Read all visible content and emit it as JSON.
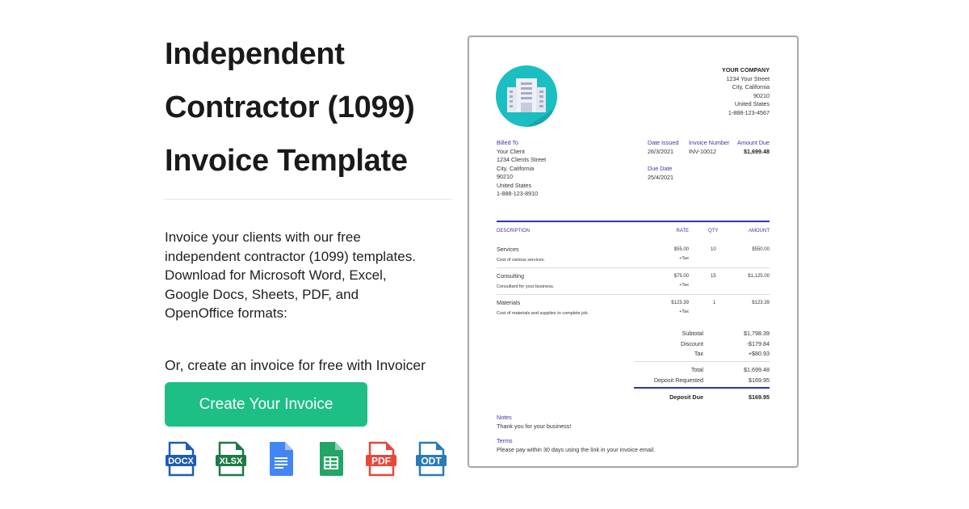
{
  "page": {
    "title_lines": [
      "Independent",
      "Contractor (1099)",
      "Invoice Template"
    ],
    "description": "Invoice your clients with our free independent contractor (1099) templates. Download for Microsoft Word, Excel, Google Docs, Sheets, PDF, and OpenOffice formats:",
    "cta_text": "Or, create an invoice for free with Invoicer",
    "cta_button": "Create Your Invoice",
    "formats": [
      {
        "label": "DOCX",
        "icon": "docx-file-icon",
        "color": "#1e5bb8"
      },
      {
        "label": "XLSX",
        "icon": "xlsx-file-icon",
        "color": "#1d7a45"
      },
      {
        "label": "",
        "icon": "google-docs-icon",
        "color": "#4285f4"
      },
      {
        "label": "",
        "icon": "google-sheets-icon",
        "color": "#23a566"
      },
      {
        "label": "PDF",
        "icon": "pdf-file-icon",
        "color": "#e8473a"
      },
      {
        "label": "ODT",
        "icon": "odt-file-icon",
        "color": "#2a7ab8"
      }
    ]
  },
  "invoice": {
    "company": {
      "name": "YOUR COMPANY",
      "street": "1234 Your Street",
      "city": "City, California",
      "zip": "90210",
      "country": "United States",
      "phone": "1-888-123-4567"
    },
    "billed_to": {
      "label": "Billed To",
      "name": "Your Client",
      "street": "1234 Clients Street",
      "city": "City, California",
      "zip": "90210",
      "country": "United States",
      "phone": "1-888-123-8910"
    },
    "date_issued": {
      "label": "Date Issued",
      "value": "26/3/2021"
    },
    "invoice_number": {
      "label": "Invoice Number",
      "value": "INV-10012"
    },
    "amount_due": {
      "label": "Amount Due",
      "value": "$1,699.48"
    },
    "due_date": {
      "label": "Due Date",
      "value": "25/4/2021"
    },
    "columns": {
      "description": "DESCRIPTION",
      "rate": "RATE",
      "qty": "QTY",
      "amount": "AMOUNT"
    },
    "items": [
      {
        "name": "Services",
        "detail": "Cost of various services.",
        "rate": "$55.00",
        "tax": "+Tax",
        "qty": "10",
        "amount": "$550.00"
      },
      {
        "name": "Consulting",
        "detail": "Consultant for your business.",
        "rate": "$75.00",
        "tax": "+Tax",
        "qty": "15",
        "amount": "$1,125.00"
      },
      {
        "name": "Materials",
        "detail": "Cost of materials and supplies to complete job.",
        "rate": "$123.39",
        "tax": "+Tax",
        "qty": "1",
        "amount": "$123.39"
      }
    ],
    "totals": {
      "subtotal": {
        "label": "Subtotal",
        "value": "$1,798.39"
      },
      "discount": {
        "label": "Discount",
        "value": "-$179.84"
      },
      "tax": {
        "label": "Tax",
        "value": "+$80.93"
      },
      "total": {
        "label": "Total",
        "value": "$1,699.48"
      },
      "deposit_requested": {
        "label": "Deposit Requested",
        "value": "$169.95"
      },
      "deposit_due": {
        "label": "Deposit Due",
        "value": "$169.95"
      }
    },
    "notes": {
      "label": "Notes",
      "text": "Thank you for your business!"
    },
    "terms": {
      "label": "Terms",
      "text": "Please pay within 30 days using the link in your invoice email."
    }
  }
}
